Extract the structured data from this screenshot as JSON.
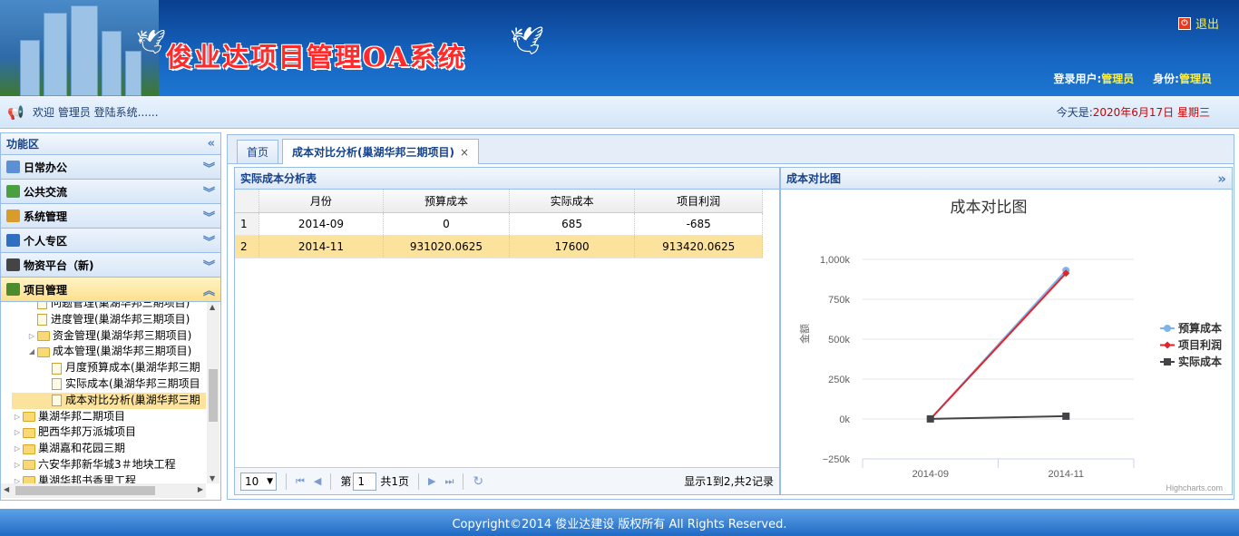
{
  "header": {
    "system_title": "俊业达项目管理OA系统",
    "logout_label": "退出",
    "login_user_label": "登录用户:",
    "login_user_value": "管理员",
    "identity_label": "身份:",
    "identity_value": "管理员"
  },
  "welcome": {
    "text": "欢迎 管理员 登陆系统......",
    "date_prefix": "今天是:",
    "date_value": "2020年6月17日 星期三"
  },
  "sidebar": {
    "title": "功能区",
    "sections": [
      {
        "label": "日常办公",
        "icon": "calendar-icon",
        "color": "#5b8fd6"
      },
      {
        "label": "公共交流",
        "icon": "pen-icon",
        "color": "#4aa040"
      },
      {
        "label": "系统管理",
        "icon": "gear-icon",
        "color": "#d99b2a"
      },
      {
        "label": "个人专区",
        "icon": "user-icon",
        "color": "#2f6fc1"
      },
      {
        "label": "物资平台（新)",
        "icon": "sigma-icon",
        "color": "#444444"
      },
      {
        "label": "项目管理",
        "icon": "project-icon",
        "color": "#4b8c2f"
      }
    ],
    "tree": [
      {
        "label": "问题管理(巢湖华邦三期项目)",
        "level": 2,
        "type": "file"
      },
      {
        "label": "进度管理(巢湖华邦三期项目)",
        "level": 2,
        "type": "file"
      },
      {
        "label": "资金管理(巢湖华邦三期项目)",
        "level": 2,
        "type": "folder",
        "expander": "▷"
      },
      {
        "label": "成本管理(巢湖华邦三期项目)",
        "level": 2,
        "type": "folder",
        "expander": "◢"
      },
      {
        "label": "月度预算成本(巢湖华邦三期",
        "level": 3,
        "type": "file"
      },
      {
        "label": "实际成本(巢湖华邦三期项目",
        "level": 3,
        "type": "file"
      },
      {
        "label": "成本对比分析(巢湖华邦三期",
        "level": 3,
        "type": "file",
        "selected": true
      },
      {
        "label": "巢湖华邦二期项目",
        "level": 1,
        "type": "folder",
        "expander": "▷"
      },
      {
        "label": "肥西华邦万派城项目",
        "level": 1,
        "type": "folder",
        "expander": "▷"
      },
      {
        "label": "巢湖嘉和花园三期",
        "level": 1,
        "type": "folder",
        "expander": "▷"
      },
      {
        "label": "六安华邦新华城3＃地块工程",
        "level": 1,
        "type": "folder",
        "expander": "▷"
      },
      {
        "label": "巢湖华邦书香里工程",
        "level": 1,
        "type": "folder",
        "expander": "▷"
      }
    ]
  },
  "tabs": [
    {
      "label": "首页",
      "active": false
    },
    {
      "label": "成本对比分析(巢湖华邦三期项目)",
      "active": true,
      "close": "×"
    }
  ],
  "grid": {
    "title": "实际成本分析表",
    "columns": [
      "月份",
      "预算成本",
      "实际成本",
      "项目利润"
    ],
    "rows": [
      {
        "n": "1",
        "cells": [
          "2014-09",
          "0",
          "685",
          "-685"
        ]
      },
      {
        "n": "2",
        "cells": [
          "2014-11",
          "931020.0625",
          "17600",
          "913420.0625"
        ]
      }
    ],
    "pager": {
      "page_size": "10",
      "page_prefix": "第",
      "page_value": "1",
      "page_suffix": "共1页",
      "info": "显示1到2,共2记录"
    }
  },
  "chart_panel": {
    "title": "成本对比图",
    "collapse_icon": "»",
    "credits": "Highcharts.com"
  },
  "chart_data": {
    "type": "line",
    "title": "成本对比图",
    "xlabel": "",
    "ylabel": "金额",
    "categories": [
      "2014-09",
      "2014-11"
    ],
    "ylim": [
      -250000,
      1000000
    ],
    "yticks": [
      -250000,
      0,
      250000,
      500000,
      750000,
      1000000
    ],
    "ytick_labels": [
      "−250k",
      "0k",
      "250k",
      "500k",
      "750k",
      "1,000k"
    ],
    "grid": true,
    "legend_position": "right",
    "series": [
      {
        "name": "预算成本",
        "values": [
          0,
          931020.0625
        ],
        "color": "#7cb5ec",
        "marker": "circle"
      },
      {
        "name": "项目利润",
        "values": [
          -685,
          913420.0625
        ],
        "color": "#e8202a",
        "marker": "diamond"
      },
      {
        "name": "实际成本",
        "values": [
          685,
          17600
        ],
        "color": "#434348",
        "marker": "square"
      }
    ]
  },
  "footer": {
    "text": "Copyright©2014 俊业达建设 版权所有 All Rights Reserved."
  }
}
